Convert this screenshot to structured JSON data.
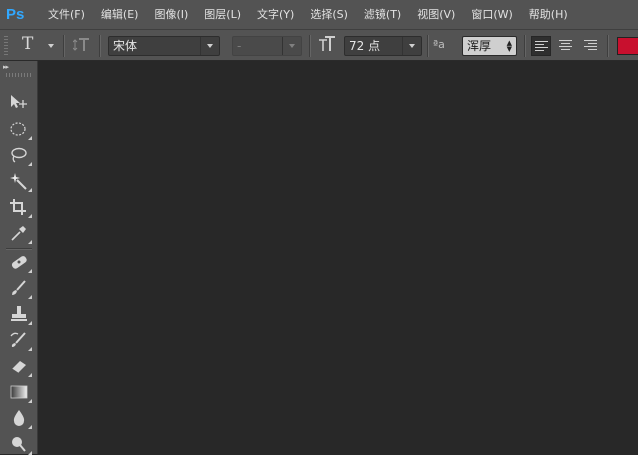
{
  "app": {
    "logo_text": "Ps"
  },
  "menu": [
    {
      "label": "文件(F)"
    },
    {
      "label": "编辑(E)"
    },
    {
      "label": "图像(I)"
    },
    {
      "label": "图层(L)"
    },
    {
      "label": "文字(Y)"
    },
    {
      "label": "选择(S)"
    },
    {
      "label": "滤镜(T)"
    },
    {
      "label": "视图(V)"
    },
    {
      "label": "窗口(W)"
    },
    {
      "label": "帮助(H)"
    }
  ],
  "options": {
    "tool_glyph": "T",
    "orient_glyph": "IT",
    "font_family": "宋体",
    "font_style": "-",
    "size_glyph": "T",
    "font_size": "72 点",
    "aa_glyph": "ªa",
    "anti_alias": "浑厚",
    "text_color": "#c8102e"
  },
  "toolbar": {
    "collapse_glyph": "▸▸",
    "tools": [
      {
        "name": "move-tool-icon"
      },
      {
        "name": "marquee-tool-icon"
      },
      {
        "name": "lasso-tool-icon"
      },
      {
        "name": "magic-wand-tool-icon"
      },
      {
        "name": "crop-tool-icon"
      },
      {
        "name": "eyedropper-tool-icon"
      },
      {
        "name": "healing-brush-tool-icon"
      },
      {
        "name": "brush-tool-icon"
      },
      {
        "name": "clone-stamp-tool-icon"
      },
      {
        "name": "history-brush-tool-icon"
      },
      {
        "name": "eraser-tool-icon"
      },
      {
        "name": "gradient-tool-icon"
      },
      {
        "name": "blur-tool-icon"
      },
      {
        "name": "dodge-tool-icon"
      }
    ]
  }
}
